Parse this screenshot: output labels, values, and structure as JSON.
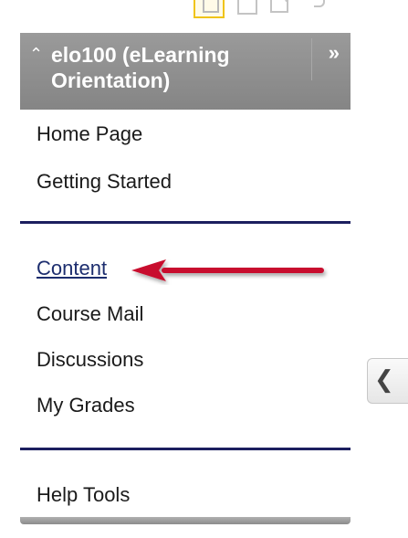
{
  "course_menu": {
    "title": "elo100 (eLearning Orientation)",
    "collapse_icon": "up-chevrons-icon",
    "expand_icon": "double-right-chevron-icon",
    "groups": [
      {
        "items": [
          {
            "label": "Home Page"
          },
          {
            "label": "Getting Started"
          }
        ]
      },
      {
        "items": [
          {
            "label": "Content",
            "highlighted": true
          },
          {
            "label": "Course Mail"
          },
          {
            "label": "Discussions"
          },
          {
            "label": "My Grades"
          }
        ]
      },
      {
        "items": [
          {
            "label": "Help Tools"
          }
        ]
      }
    ]
  },
  "toolbar": {
    "icons": [
      "list-view-icon",
      "folder-view-icon",
      "edit-view-icon",
      "refresh-icon"
    ]
  },
  "side_tab": {
    "icon": "chevron-left-icon"
  },
  "annotation": {
    "type": "red-arrow",
    "color": "#c8102e",
    "points_to": "Content"
  },
  "colors": {
    "header_bg": "#8f8f8f",
    "divider": "#1c1f5f",
    "link": "#1c2d6e"
  }
}
